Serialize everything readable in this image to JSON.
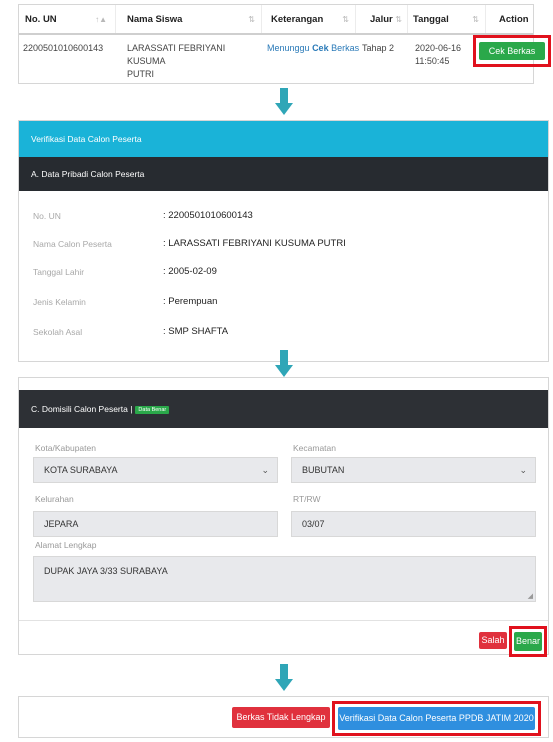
{
  "table": {
    "headers": [
      {
        "label": "No. UN",
        "sort": "↑▲"
      },
      {
        "label": "Nama Siswa",
        "sort": "⇅"
      },
      {
        "label": "Keterangan",
        "sort": "⇅"
      },
      {
        "label": "Jalur",
        "sort": "⇅"
      },
      {
        "label": "Tanggal",
        "sort": "⇅"
      },
      {
        "label": "Action",
        "sort": "⇅"
      }
    ],
    "row": {
      "no_un": "2200501010600143",
      "nama_line1": "LARASSATI FEBRIYANI KUSUMA",
      "nama_line2": "PUTRI",
      "keterangan_prefix": "Menunggu",
      "keterangan_bold": "Cek",
      "keterangan_suffix": "Berkas",
      "jalur": "Tahap 2",
      "tanggal_date": "2020-06-16",
      "tanggal_time": "11:50:45",
      "action_label": "Cek Berkas"
    }
  },
  "verification": {
    "title": "Verifikasi Data Calon Peserta",
    "section": "A. Data Pribadi Calon Peserta",
    "rows": [
      {
        "label": "No. UN",
        "value": ": 2200501010600143"
      },
      {
        "label": "Nama Calon Peserta",
        "value": ": LARASSATI FEBRIYANI KUSUMA PUTRI"
      },
      {
        "label": "Tanggal Lahir",
        "value": ": 2005-02-09"
      },
      {
        "label": "Jenis Kelamin",
        "value": ": Perempuan"
      },
      {
        "label": "Sekolah Asal",
        "value": ": SMP SHAFTA"
      }
    ]
  },
  "domicile": {
    "title": "C. Domisili Calon Peserta |",
    "badge": "Data Benar",
    "kota_label": "Kota/Kabupaten",
    "kota_value": "KOTA SURABAYA",
    "kecamatan_label": "Kecamatan",
    "kecamatan_value": "BUBUTAN",
    "kelurahan_label": "Kelurahan",
    "kelurahan_value": "JEPARA",
    "rtrw_label": "RT/RW",
    "rtrw_value": "03/07",
    "alamat_label": "Alamat Lengkap",
    "alamat_value": "DUPAK JAYA 3/33 SURABAYA",
    "salah_label": "Salah",
    "benar_label": "Benar"
  },
  "actions": {
    "berkas_label": "Berkas Tidak Lengkap",
    "verif_label": "Verifikasi Data Calon Peserta PPDB JATIM 2020"
  },
  "colors": {
    "header_cyan": "#1ab3d8",
    "dark_bar": "#272b30",
    "green": "#2aa84a",
    "red": "#e0313d",
    "blue": "#2f8fdf",
    "highlight": "#e0111d",
    "arrow": "#2fa6b7"
  }
}
